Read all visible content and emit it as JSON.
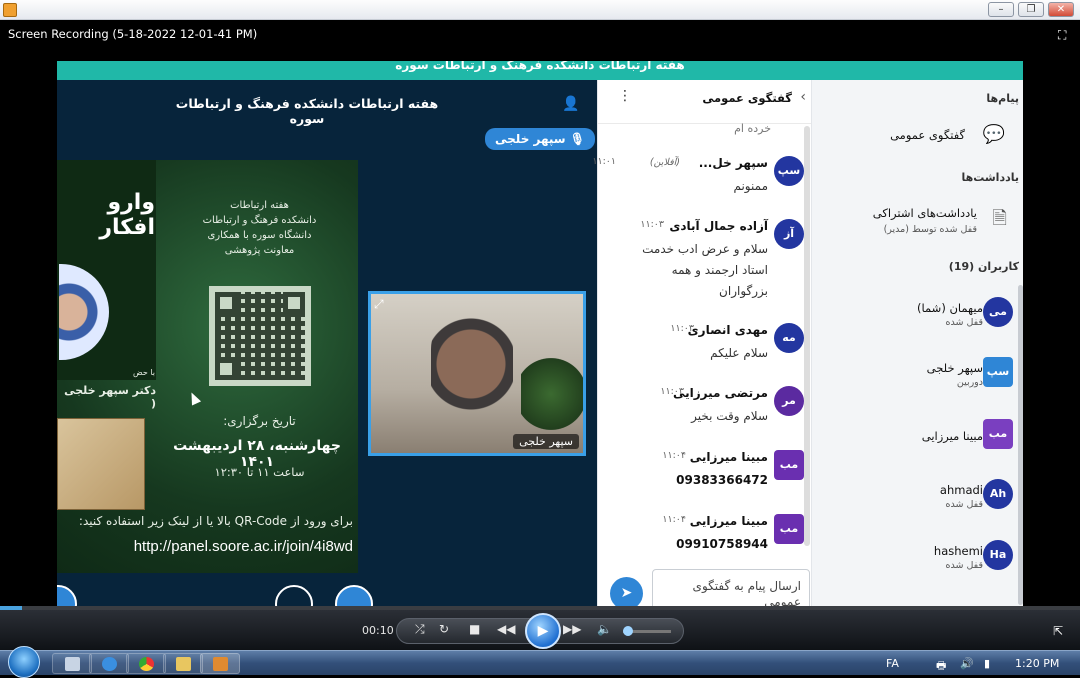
{
  "window": {
    "title": "Screen Recording (5-18-2022 12-01-41 PM)"
  },
  "meeting": {
    "top_strip": "هفته ارتباطات دانشکده فرهنگ و ارتباطات سوره",
    "stage_title": "هفته ارتباطات دانشکده فرهنگ و ارتباطات سوره",
    "speaker": "سپهر خلجی",
    "webcam_name": "سپهر خلجی"
  },
  "slide": {
    "poster_title": "وارو\nافکار",
    "poster_person": "دکتر سپهر خلجی (",
    "poster_with": "با حض",
    "header_lines": [
      "هفته ارتباطات",
      "دانشکده فرهنگ و ارتباطات",
      "دانشگاه سوره با همکاری",
      "معاونت پژوهشی"
    ],
    "date_label": "تاریخ برگزاری:",
    "date_value": "چهارشنبه، ۲۸ اردیبهشت ۱۴۰۱",
    "time_value": "ساعت ۱۱ تا ۱۲:۳۰",
    "join_text": "برای ورود از QR-Code بالا یا از لینک زیر استفاده کنید:",
    "join_link": "http://panel.soore.ac.ir/join/4i8wd"
  },
  "chat": {
    "title": "گفتگوی عمومی",
    "partial_top": "خرده ام",
    "input_placeholder": "ارسال پیام به گفتگوی عمومی",
    "messages": [
      {
        "avatar": "سپ",
        "name": "سپهر خل...",
        "status": "(آفلاین)",
        "time": "۱۱:۰۱",
        "text": "ممنونم",
        "color": "#2336a0"
      },
      {
        "avatar": "آز",
        "name": "آزاده جمال آبادی",
        "status": "",
        "time": "۱۱:۰۳",
        "text": "سلام و عرض ادب خدمت استاد ارجمند و همه بزرگواران",
        "color": "#2336a0"
      },
      {
        "avatar": "مه",
        "name": "مهدی انصاری",
        "status": "",
        "time": "۱۱:۰۳",
        "text": "سلام علیکم",
        "color": "#2336a0"
      },
      {
        "avatar": "مر",
        "name": "مرتضی میرزایی",
        "status": "",
        "time": "۱۱:۰۳",
        "text": "سلام وقت بخیر",
        "color": "#5b2aa0"
      },
      {
        "avatar": "مب",
        "name": "مبینا میرزایی",
        "status": "",
        "time": "۱۱:۰۴",
        "text": "09383366472",
        "color": "#6a2fb0"
      },
      {
        "avatar": "مب",
        "name": "مبینا میرزایی",
        "status": "",
        "time": "۱۱:۰۴",
        "text": "09910758944",
        "color": "#6a2fb0"
      }
    ]
  },
  "panel": {
    "messages_header": "پیام‌ها",
    "public_chat": "گفتگوی عمومی",
    "notes_header": "یادداشت‌ها",
    "shared_notes": "یادداشت‌های اشتراکی",
    "shared_notes_sub": "قفل شده توسط (مدیر)",
    "users_header": "کاربران (19)",
    "users": [
      {
        "avatar": "می",
        "name": "میهمان (شما)",
        "sub": "قفل شده",
        "color": "#2336a0",
        "square": false
      },
      {
        "avatar": "سپ",
        "name": "سپهر خلجی",
        "sub": "دوربین",
        "color": "#2f86d6",
        "square": true
      },
      {
        "avatar": "مب",
        "name": "مبینا میرزایی",
        "sub": "",
        "color": "#7a3fc0",
        "square": true
      },
      {
        "avatar": "Ah",
        "name": "ahmadi",
        "sub": "قفل شده",
        "color": "#2336a0",
        "square": false
      },
      {
        "avatar": "Ha",
        "name": "hashemi",
        "sub": "قفل شده",
        "color": "#2336a0",
        "square": false
      }
    ]
  },
  "player": {
    "time": "00:10"
  },
  "taskbar": {
    "lang": "FA",
    "clock": "1:20 PM"
  }
}
